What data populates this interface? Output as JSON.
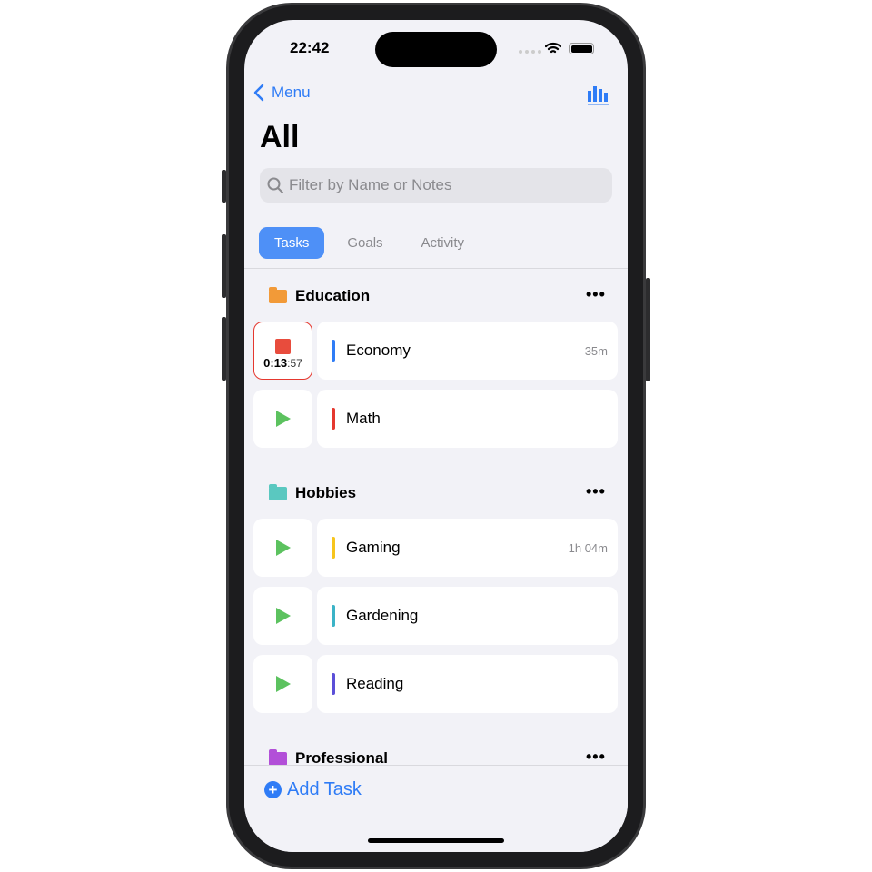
{
  "status": {
    "time": "22:42"
  },
  "nav": {
    "back_label": "Menu",
    "title": "All"
  },
  "search": {
    "placeholder": "Filter by Name or Notes"
  },
  "tabs": [
    {
      "label": "Tasks",
      "active": true
    },
    {
      "label": "Goals"
    },
    {
      "label": "Activity"
    }
  ],
  "groups": [
    {
      "name": "Education",
      "color": "#f29a38",
      "tasks": [
        {
          "name": "Economy",
          "color": "#2f7cf6",
          "duration": "35m",
          "running": true,
          "timer_main": "0:13",
          "timer_sec": ":57"
        },
        {
          "name": "Math",
          "color": "#e5382f",
          "duration": ""
        }
      ]
    },
    {
      "name": "Hobbies",
      "color": "#5ac8c0",
      "tasks": [
        {
          "name": "Gaming",
          "color": "#f7c51d",
          "duration": "1h 04m"
        },
        {
          "name": "Gardening",
          "color": "#3bb3c7",
          "duration": ""
        },
        {
          "name": "Reading",
          "color": "#5b4fd8",
          "duration": ""
        }
      ]
    },
    {
      "name": "Professional",
      "color": "#b24fd8",
      "tasks": []
    }
  ],
  "footer": {
    "add_label": "Add Task"
  }
}
